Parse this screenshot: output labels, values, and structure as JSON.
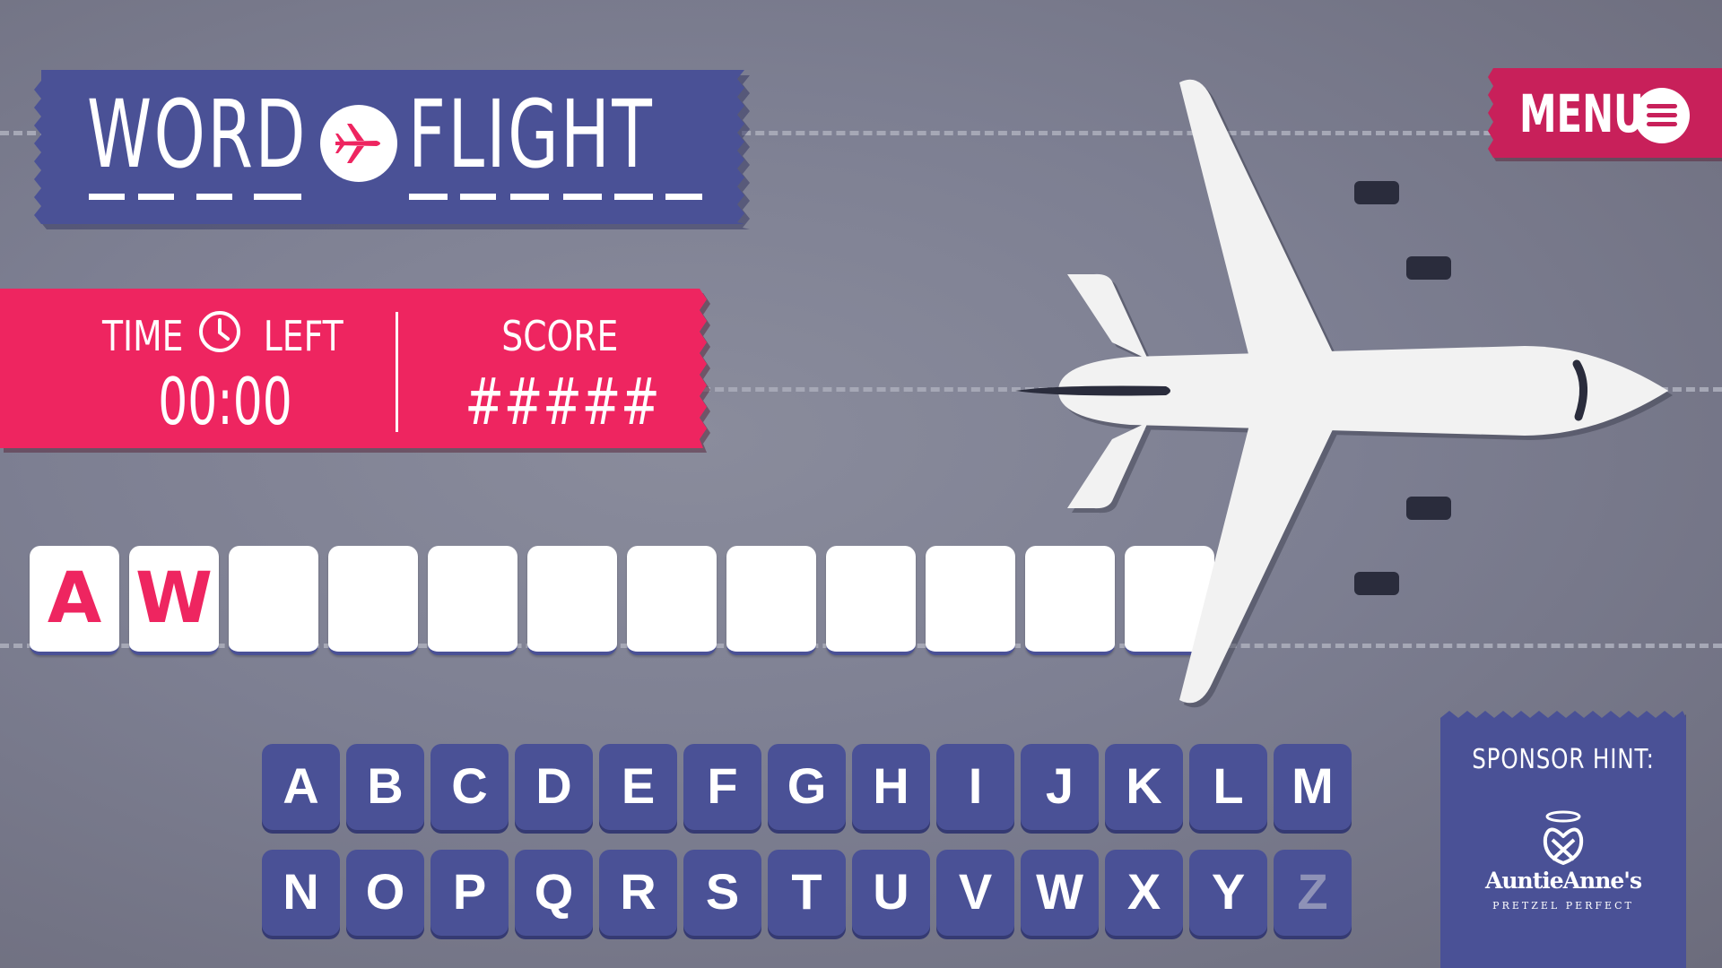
{
  "game": {
    "title_word_1": "WORD",
    "title_word_2": "FLIGHT",
    "time_label_1": "TIME",
    "time_label_2": "LEFT",
    "time_value": "00:00",
    "score_label": "SCORE",
    "score_value": "#####",
    "menu_label": "MENU"
  },
  "answer": {
    "slots": [
      "A",
      "W",
      "",
      "",
      "",
      "",
      "",
      "",
      "",
      "",
      "",
      ""
    ]
  },
  "keyboard": {
    "row1": [
      "A",
      "B",
      "C",
      "D",
      "E",
      "F",
      "G",
      "H",
      "I",
      "J",
      "K",
      "L",
      "M"
    ],
    "row2": [
      "N",
      "O",
      "P",
      "Q",
      "R",
      "S",
      "T",
      "U",
      "V",
      "W",
      "X",
      "Y",
      "Z"
    ],
    "used_keys": [
      "Z"
    ]
  },
  "sponsor": {
    "label": "SPONSOR HINT:",
    "brand": "AuntieAnne's",
    "tagline": "PRETZEL PERFECT"
  },
  "colors": {
    "navy": "#4a5196",
    "pink": "#ee2560",
    "menu_red": "#c8205a",
    "background": "#7d7f92"
  }
}
